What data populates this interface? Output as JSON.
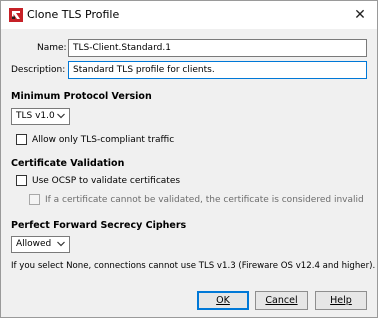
{
  "window": {
    "title": "Clone TLS Profile",
    "close_glyph": "✕",
    "app_icon": "watchguard-logo-icon"
  },
  "form": {
    "name_label": "Name:",
    "name_value": "TLS-Client.Standard.1",
    "description_label": "Description:",
    "description_value": "Standard TLS profile for clients."
  },
  "protocol": {
    "heading": "Minimum Protocol Version",
    "selected": "TLS v1.0",
    "allow_only_label": "Allow only TLS-compliant traffic",
    "allow_only_checked": false
  },
  "cert": {
    "heading": "Certificate Validation",
    "ocsp_label": "Use OCSP to validate certificates",
    "ocsp_checked": false,
    "invalid_label": "If a certificate cannot be validated, the certificate is considered invalid",
    "invalid_checked": false
  },
  "pfs": {
    "heading": "Perfect Forward Secrecy Ciphers",
    "selected": "Allowed",
    "note": "If you select None, connections cannot use TLS v1.3 (Fireware OS v12.4 and higher)."
  },
  "buttons": {
    "ok": "OK",
    "cancel": "Cancel",
    "help": "Help"
  },
  "colors": {
    "focus": "#0078d7",
    "dialog_bg": "#f0f0f0",
    "logo_red": "#c62127"
  }
}
